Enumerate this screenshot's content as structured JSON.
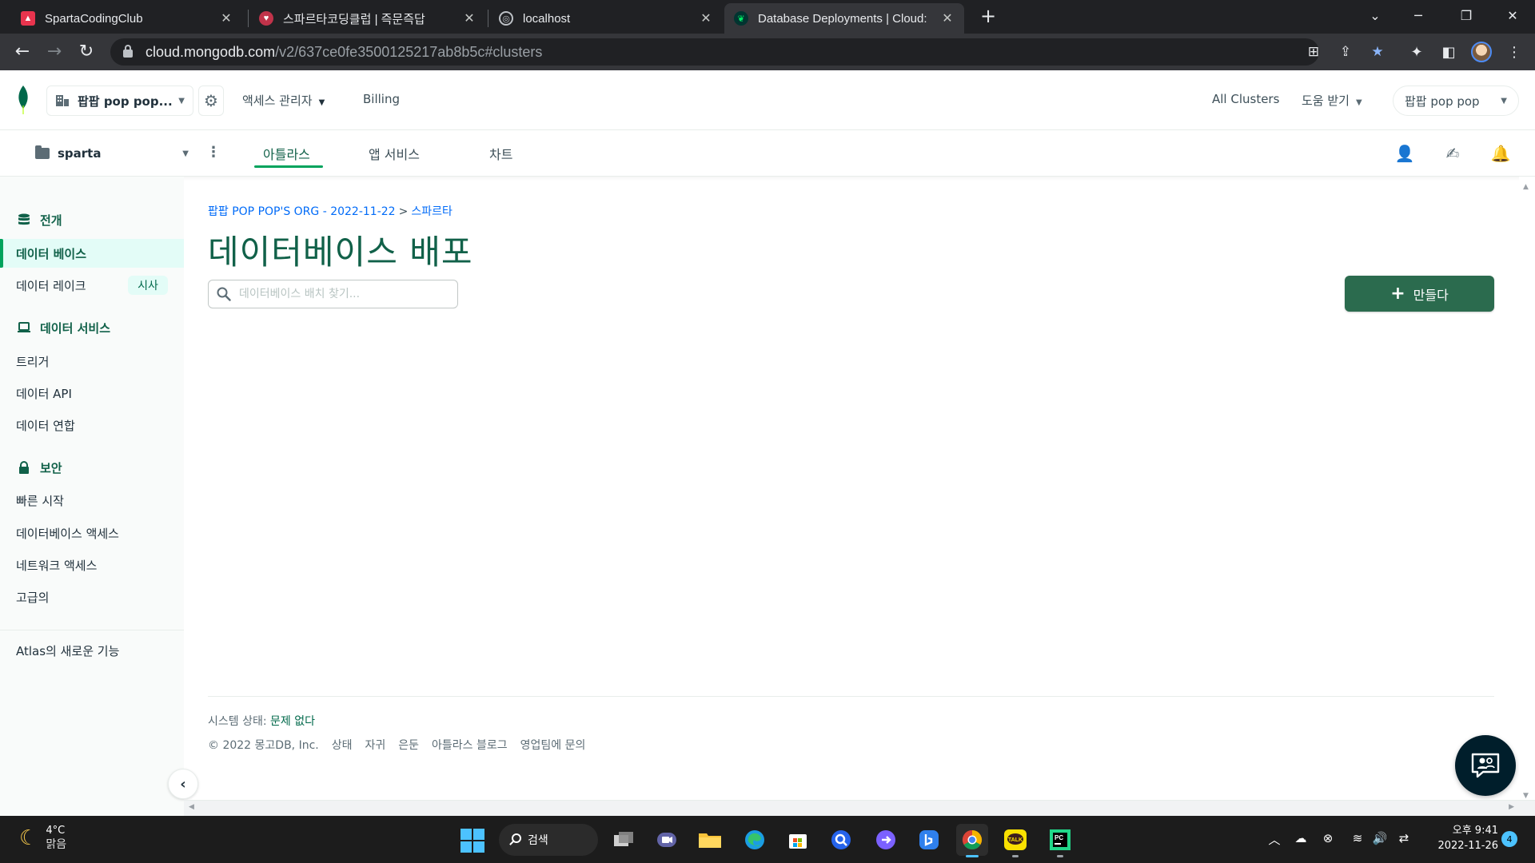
{
  "browser": {
    "tabs": [
      {
        "title": "SpartaCodingClub",
        "close": "✕"
      },
      {
        "title": "스파르타코딩클럽 | 즉문즉답",
        "close": "✕"
      },
      {
        "title": "localhost",
        "close": "✕"
      },
      {
        "title": "Database Deployments | Cloud:",
        "close": "✕"
      }
    ],
    "new_tab": "+",
    "url_host": "cloud.mongodb.com",
    "url_path": "/v2/637ce0fe3500125217ab8b5c#clusters"
  },
  "atlas_top": {
    "org_name": "팝팝 pop pop...",
    "access_manager": "액세스 관리자",
    "billing": "Billing",
    "all_clusters": "All Clusters",
    "help": "도움 받기",
    "user": "팝팝 pop pop"
  },
  "project_bar": {
    "project": "sparta",
    "tabs": [
      "아틀라스",
      "앱 서비스",
      "차트"
    ]
  },
  "sidebar": {
    "deploy_header": "전개",
    "database": "데이터 베이스",
    "data_lake": "데이터 레이크",
    "data_lake_badge": "시사",
    "data_services_header": "데이터 서비스",
    "triggers": "트리거",
    "data_api": "데이터 API",
    "data_federation": "데이터 연합",
    "security_header": "보안",
    "quick_start": "빠른 시작",
    "db_access": "데이터베이스 액세스",
    "network_access": "네트워크 액세스",
    "advanced": "고급의",
    "whats_new": "Atlas의 새로운 기능"
  },
  "main": {
    "breadcrumb_org": "팝팝 POP POP'S ORG - 2022-11-22",
    "breadcrumb_sep": ">",
    "breadcrumb_project": "스파르타",
    "title": "데이터베이스 배포",
    "search_placeholder": "데이터베이스 배치 찾기...",
    "create_plus": "+",
    "create_label": "만들다"
  },
  "footer": {
    "status_label": "시스템 상태:",
    "status_value": "문제 없다",
    "copyright": "© 2022 몽고DB, Inc.",
    "links": [
      "상태",
      "자귀",
      "은둔",
      "아틀라스 블로그",
      "영업팀에 문의"
    ]
  },
  "taskbar": {
    "temp": "4°C",
    "weather": "맑음",
    "search": "검색",
    "time": "오후 9:41",
    "date": "2022-11-26",
    "notifications": "4"
  },
  "colors": {
    "atlas_green_dark": "#116149",
    "atlas_green": "#00a35c",
    "create_button": "#2b6b4e",
    "link_blue": "#016bf8",
    "sidebar_active": "#e3fcf7"
  }
}
